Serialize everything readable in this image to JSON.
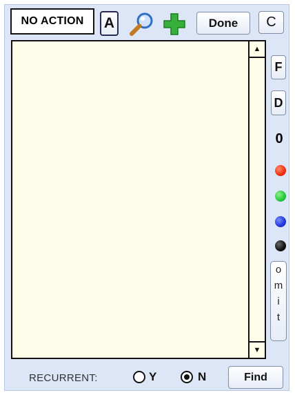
{
  "toolbar": {
    "action_status": "NO ACTION",
    "a_label": "A",
    "search_icon": "magnifier-icon",
    "add_icon": "plus-icon",
    "done_label": "Done",
    "c_label": "C"
  },
  "list": {
    "items": []
  },
  "side": {
    "f_label": "F",
    "d_label": "D",
    "count": "0",
    "dots": [
      {
        "name": "red",
        "color": "#f03010"
      },
      {
        "name": "green",
        "color": "#22c93a"
      },
      {
        "name": "blue",
        "color": "#2036d8"
      },
      {
        "name": "black",
        "color": "#111111"
      }
    ],
    "omit_letters": [
      "o",
      "m",
      "i",
      "t"
    ]
  },
  "bottom": {
    "recurrent_label": "RECURRENT:",
    "yes_label": "Y",
    "no_label": "N",
    "selected": "N",
    "find_label": "Find"
  }
}
